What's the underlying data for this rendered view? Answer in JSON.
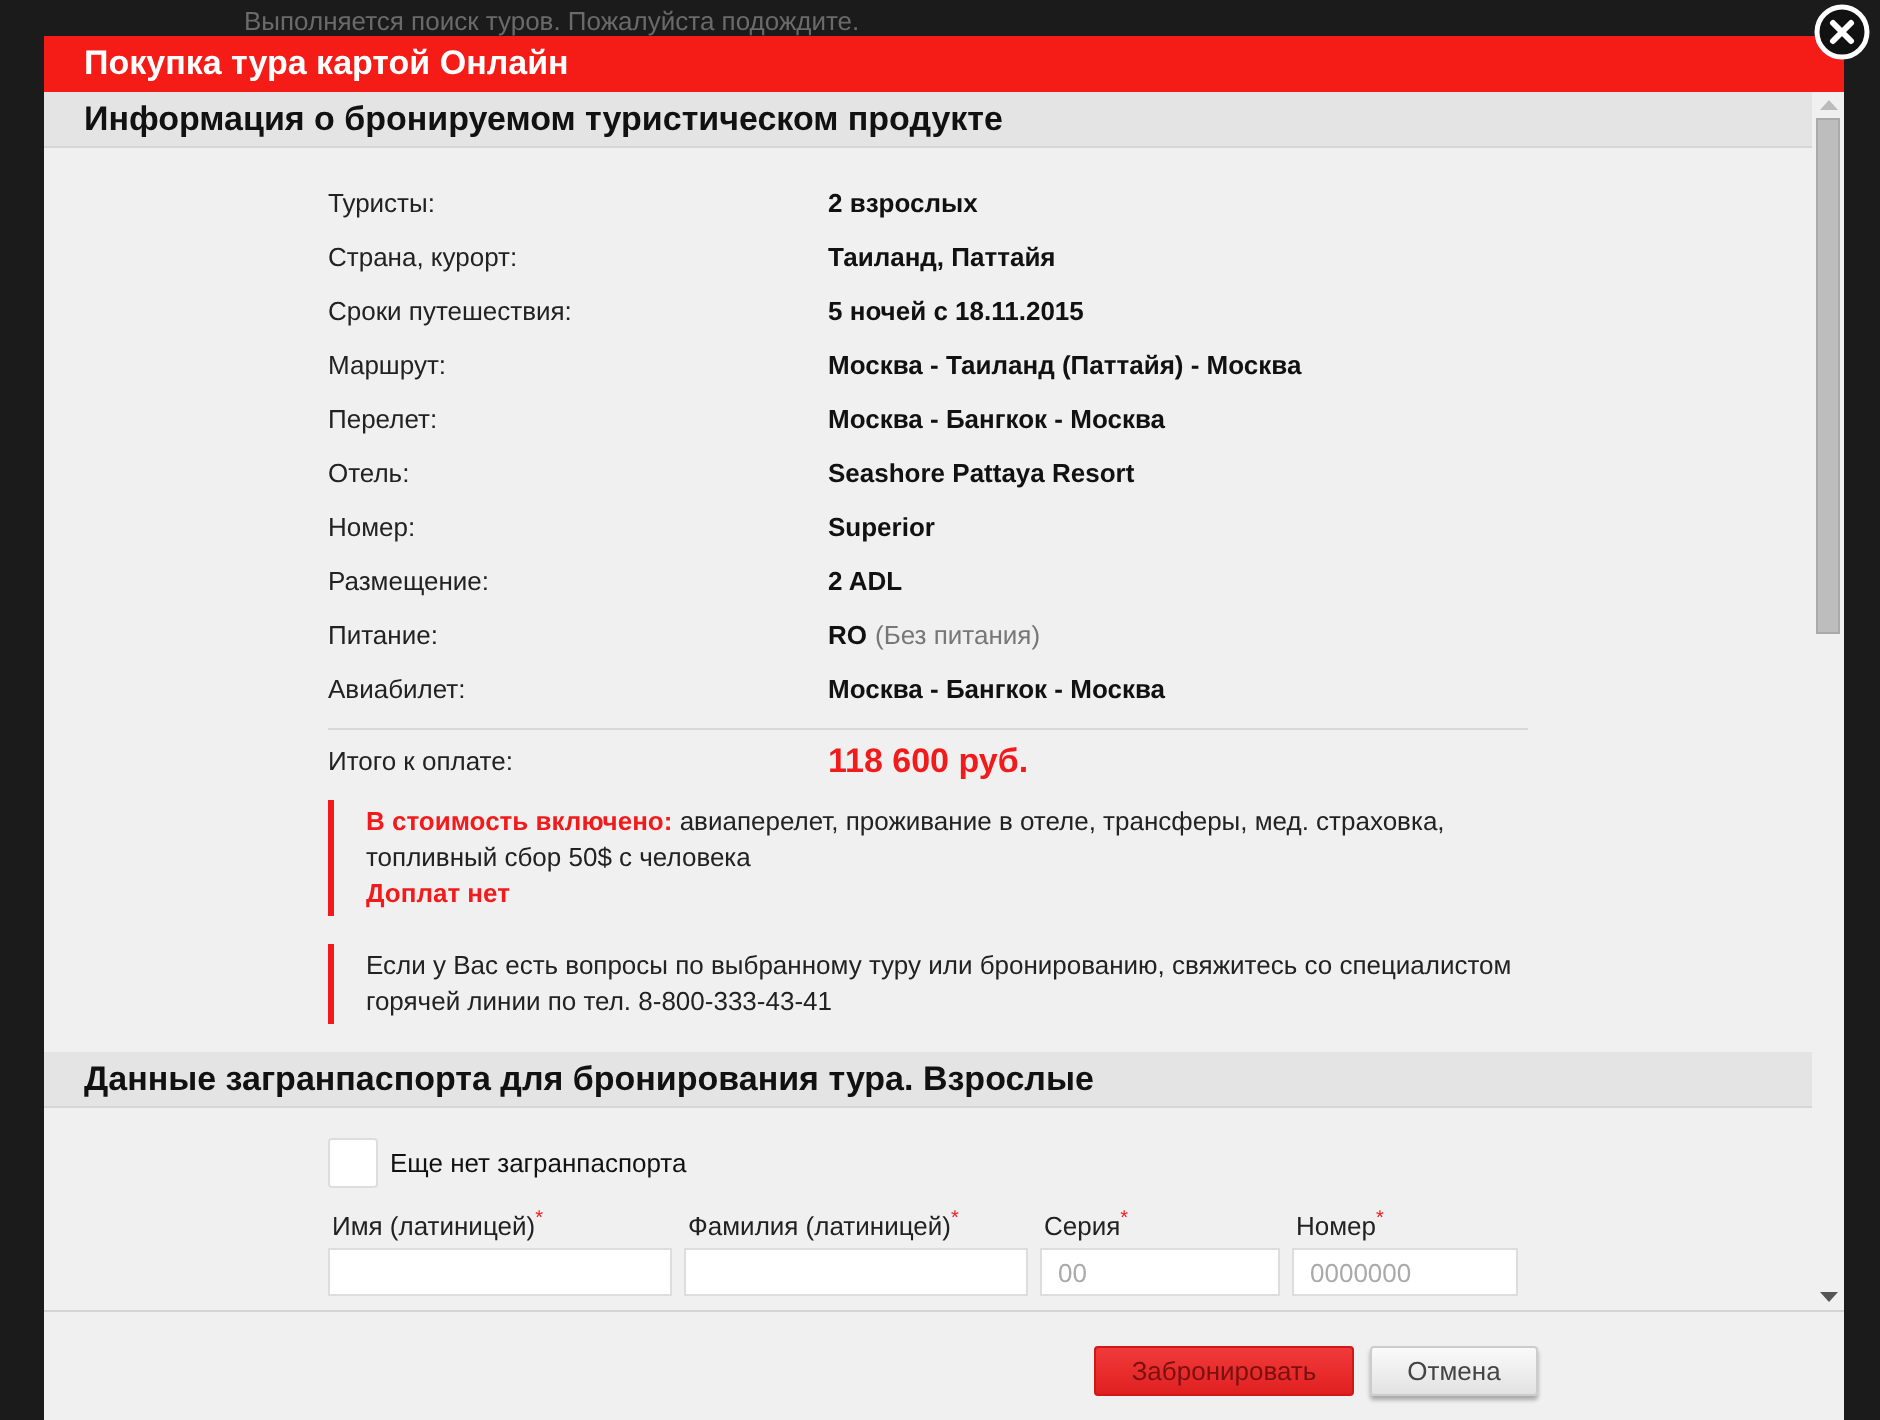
{
  "background": {
    "status_text": "Выполняется поиск туров. Пожалуйста подождите."
  },
  "dialog": {
    "title": "Покупка тура картой Онлайн"
  },
  "info_section": {
    "heading": "Информация о бронируемом туристическом продукте",
    "rows": [
      {
        "label": "Туристы:",
        "value": "2 взрослых"
      },
      {
        "label": "Страна, курорт:",
        "value": "Таиланд, Паттайя"
      },
      {
        "label": "Сроки путешествия:",
        "value": "5 ночей с 18.11.2015"
      },
      {
        "label": "Маршрут:",
        "value": "Москва - Таиланд (Паттайя) - Москва"
      },
      {
        "label": "Перелет:",
        "value": "Москва - Бангкок - Москва"
      },
      {
        "label": "Отель:",
        "value": "Seashore Pattaya Resort"
      },
      {
        "label": "Номер:",
        "value": "Superior"
      },
      {
        "label": "Размещение:",
        "value": "2 ADL"
      },
      {
        "label": "Питание:",
        "value": "RO",
        "note": "(Без питания)"
      },
      {
        "label": "Авиабилет:",
        "value": "Москва - Бангкок - Москва"
      }
    ],
    "total": {
      "label": "Итого к оплате:",
      "value": "118 600 руб."
    },
    "notes": [
      {
        "text": "**В стоимость включено:** авиаперелет, проживание в отеле, трансферы, мед. страховка, топливный сбор 50$ с человека",
        "extra": "Доплат нет"
      },
      {
        "text": "Если у Вас есть вопросы по выбранному туру или бронированию, свяжитесь со специалистом горячей линии по тел. 8-800-333-43-41"
      }
    ]
  },
  "passport_section": {
    "heading": "Данные загранпаспорта для бронирования тура. Взрослые",
    "no_passport": {
      "label": "Еще нет загранпаспорта",
      "checked": false
    },
    "fields": [
      {
        "label": "Имя (латиницей)$^{*}$"
      },
      {
        "label": "Фамилия (латиницей)$^{*}$"
      },
      {
        "label": "Серия$^{*}$",
        "placeholder": "00"
      },
      {
        "label": "Номер$^{*}$",
        "placeholder": "0000000"
      }
    ]
  },
  "buttons": [
    {
      "label": "Забронировать",
      "kind": "primary"
    },
    {
      "label": "Отмена",
      "kind": "secondary"
    }
  ]
}
